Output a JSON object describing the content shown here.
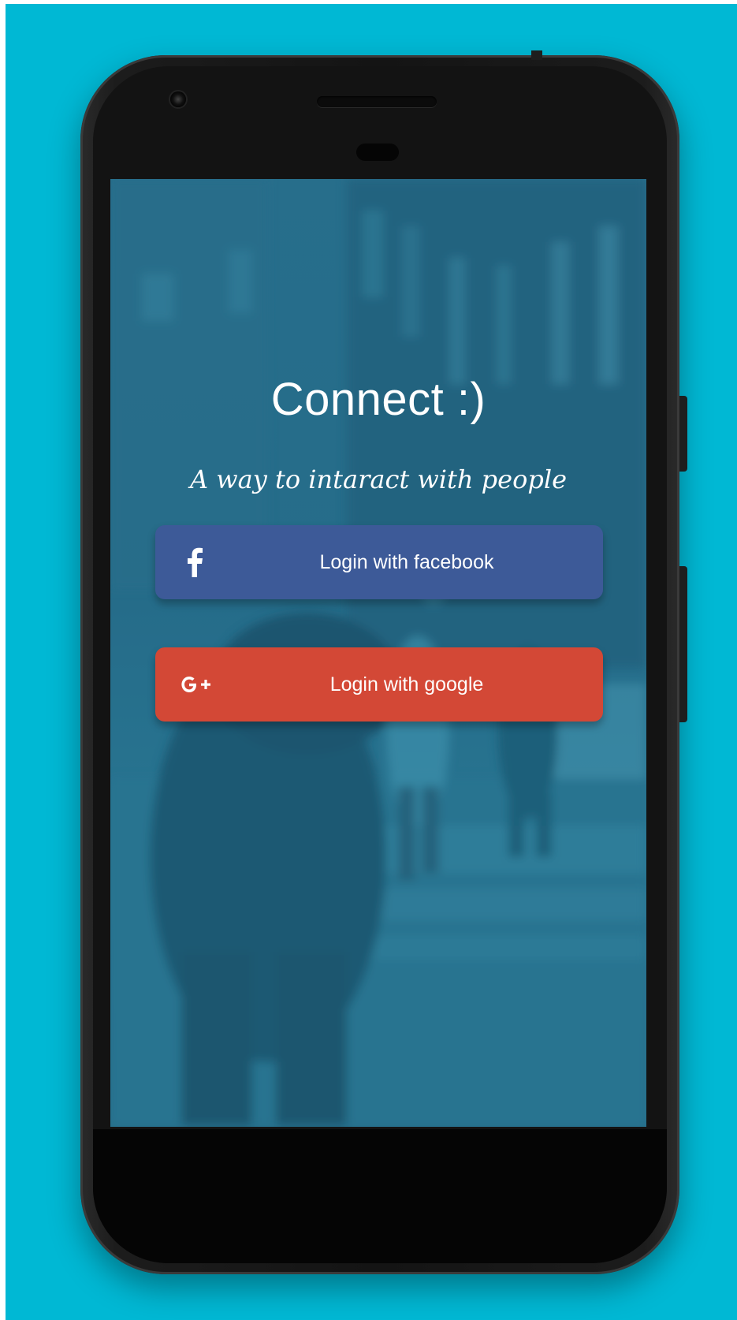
{
  "app": {
    "title": "Connect :)",
    "tagline": "A way to intaract with people"
  },
  "buttons": {
    "facebook": {
      "label": "Login with facebook",
      "icon": "facebook-icon",
      "color": "#3d5a98"
    },
    "google": {
      "label": "Login with google",
      "icon": "google-plus-icon",
      "color": "#d34836"
    }
  },
  "theme": {
    "background": "#00b8d4",
    "screen_tint": "#2a6f8c"
  }
}
